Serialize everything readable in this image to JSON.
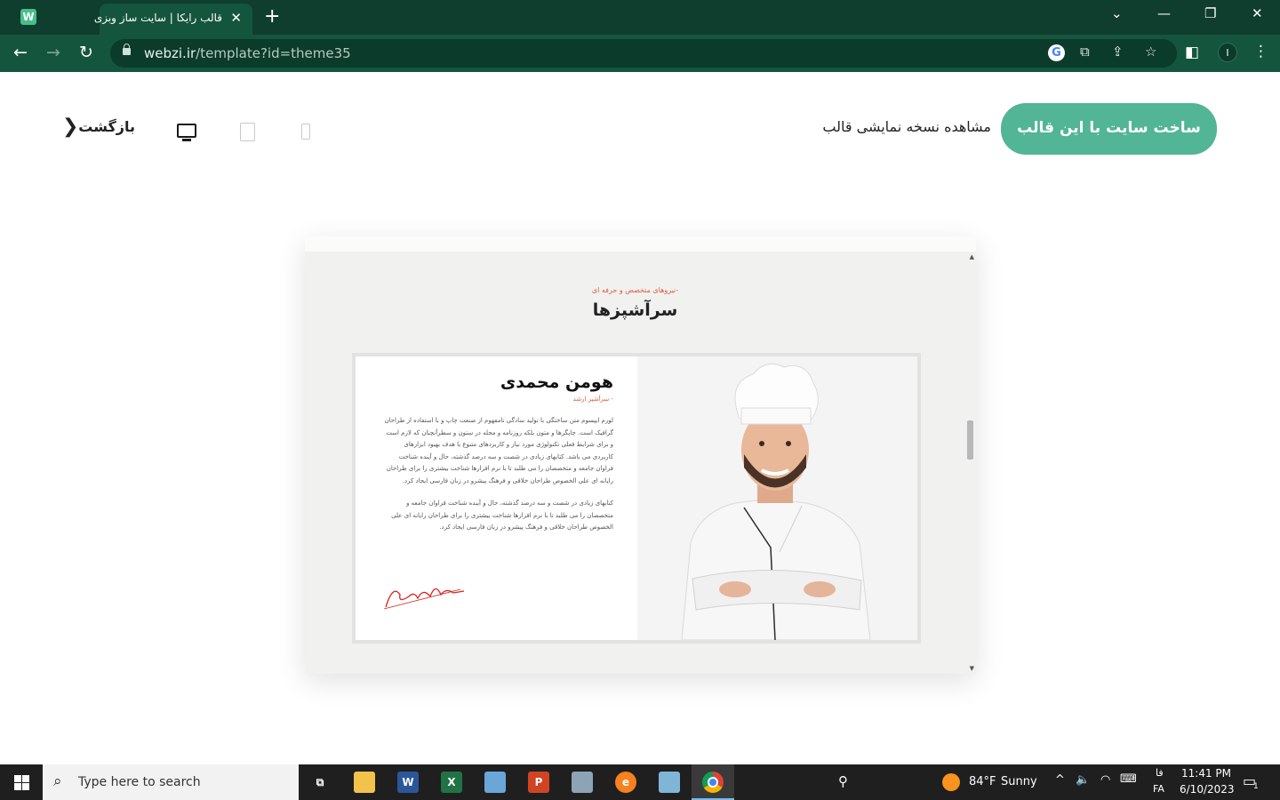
{
  "browser": {
    "app_icon_letter": "W",
    "tab_title": "قالب رایکا | سایت ساز وبزی",
    "tab_close": "✕",
    "new_tab": "+",
    "url_host": "webzi.ir",
    "url_path": "/template?id=theme35",
    "profile_initial": "I",
    "window_controls": {
      "dropdown": "⌄",
      "minimize": "—",
      "restore": "❐",
      "close": "✕"
    }
  },
  "page": {
    "build_button": "ساخت سایت با این قالب",
    "demo_link": "مشاهده نسخه نمایشی قالب",
    "back_label": "بازگشت",
    "back_chevron": "❮",
    "selected_device": "desktop"
  },
  "preview": {
    "section_subtitle": "-نیروهای متخصص و حرفه ای",
    "section_title": "سرآشپزها",
    "chef_name": "هومن محمدی",
    "chef_role": "- سرآشپز ارشد",
    "bio_paragraph_1": "لورم ایپسوم متن ساختگی با تولید سادگی نامفهوم از صنعت چاپ و با استفاده از طراحان گرافیک است. چاپگرها و متون بلکه روزنامه و مجله در ستون و سطرآنچنان که لازم است و برای شرایط فعلی تکنولوژی مورد نیاز و کاربردهای متنوع با هدف بهبود ابزارهای کاربردی می باشد. کتابهای زیادی در شصت و سه درصد گذشته، حال و آینده شناخت فراوان جامعه و متخصصان را می طلبد تا با نرم افزارها شناخت بیشتری را برای طراحان رایانه ای علی الخصوص طراحان خلاقی و فرهنگ پیشرو در زبان فارسی ایجاد کرد.",
    "bio_paragraph_2": "کتابهای زیادی در شصت و سه درصد گذشته، حال و آینده شناخت فراوان جامعه و متخصصان را می طلبد تا با نرم افزارها شناخت بیشتری را برای طراحان رایانه ای علی الخصوص طراحان خلاقی و فرهنگ پیشرو در زبان فارسی ایجاد کرد.",
    "signature_color": "#d8231e"
  },
  "taskbar": {
    "search_placeholder": "Type here to search",
    "weather_temp": "84°F",
    "weather_cond": "Sunny",
    "lang_top": "فا",
    "lang_bottom": "FA",
    "time": "11:41 PM",
    "date": "6/10/2023",
    "notification_count": "1"
  },
  "colors": {
    "chrome_dark": "#0f3d2e",
    "chrome_toolbar": "#14553d",
    "accent_green": "#51b596",
    "accent_red": "#e05a3a"
  }
}
